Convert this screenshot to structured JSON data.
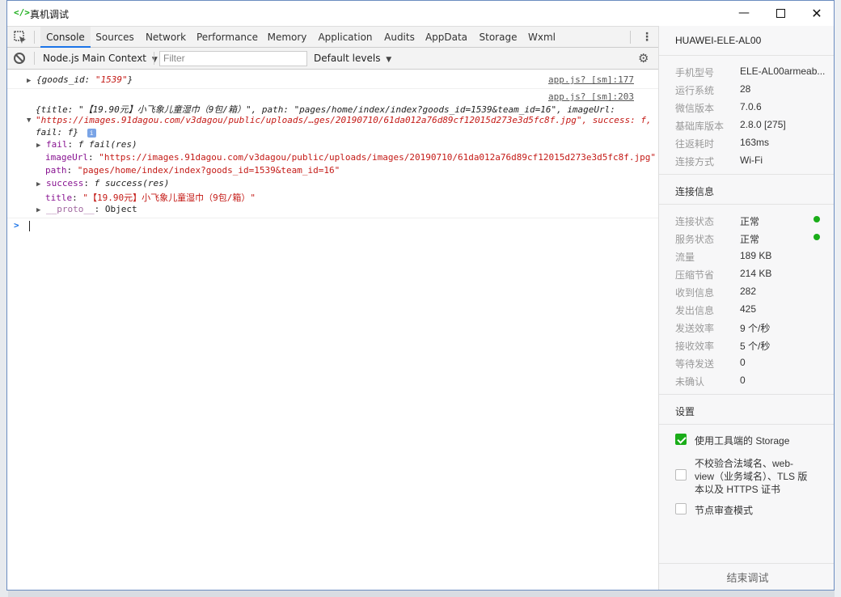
{
  "window": {
    "icon_text": "</>",
    "title": "真机调试"
  },
  "tabs": [
    "Console",
    "Sources",
    "Network",
    "Performance",
    "Memory",
    "Application",
    "Audits",
    "AppData",
    "Storage",
    "Wxml"
  ],
  "toolbar": {
    "context": "Node.js Main Context",
    "filter_placeholder": "Filter",
    "levels": "Default levels"
  },
  "console": {
    "line1": {
      "text": "{goods_id: ",
      "value": "\"1539\"",
      "end": "}",
      "source": "app.js? [sm]:177"
    },
    "line2": {
      "source": "app.js? [sm]:203",
      "summary1": "{title: \"【19.90元】小飞象儿童湿巾（9包/箱）\", path: \"pages/home/index/index?goods_id=1539&team_id=16\", imageUrl:",
      "summary2": "\"https://images.91dagou.com/v3dagou/public/uploads/…ges/20190710/61da012a76d89cf12015d273e3d5fc8f.jpg\", success: f,",
      "summary3": "fail: f}",
      "info_badge": "i",
      "props": [
        {
          "key": "fail",
          "value": "f fail(res)"
        },
        {
          "key": "imageUrl",
          "value": "\"https://images.91dagou.com/v3dagou/public/uploads/images/20190710/61da012a76d89cf12015d273e3d5fc8f.jpg\""
        },
        {
          "key": "path",
          "value": "\"pages/home/index/index?goods_id=1539&team_id=16\""
        },
        {
          "key": "success",
          "value": "f success(res)"
        },
        {
          "key": "title",
          "value": "\"【19.90元】小飞象儿童湿巾（9包/箱）\""
        },
        {
          "key": "__proto__",
          "value": "Object"
        }
      ]
    },
    "prompt": ">"
  },
  "device": {
    "name": "HUAWEI-ELE-AL00",
    "info": [
      {
        "label": "手机型号",
        "value": "ELE-AL00armeab..."
      },
      {
        "label": "运行系统",
        "value": "28"
      },
      {
        "label": "微信版本",
        "value": "7.0.6"
      },
      {
        "label": "基础库版本",
        "value": "2.8.0 [275]"
      },
      {
        "label": "往返耗时",
        "value": "163ms"
      },
      {
        "label": "连接方式",
        "value": "Wi-Fi"
      }
    ],
    "conn_title": "连接信息",
    "conn": [
      {
        "label": "连接状态",
        "value": "正常"
      },
      {
        "label": "服务状态",
        "value": "正常"
      },
      {
        "label": "流量",
        "value": "189 KB"
      },
      {
        "label": "压缩节省",
        "value": "214 KB"
      },
      {
        "label": "收到信息",
        "value": "282"
      },
      {
        "label": "发出信息",
        "value": "425"
      },
      {
        "label": "发送效率",
        "value": "9 个/秒"
      },
      {
        "label": "接收效率",
        "value": "5 个/秒"
      },
      {
        "label": "等待发送",
        "value": "0"
      },
      {
        "label": "未确认",
        "value": "0"
      }
    ],
    "settings_title": "设置",
    "settings": {
      "storage": "使用工具端的 Storage",
      "domain_line1": "不校验合法域名、web-",
      "domain_line2": "view（业务域名）、TLS 版",
      "domain_line3": "本以及 HTTPS 证书",
      "audit": "节点审查模式"
    },
    "end_button": "结束调试"
  }
}
